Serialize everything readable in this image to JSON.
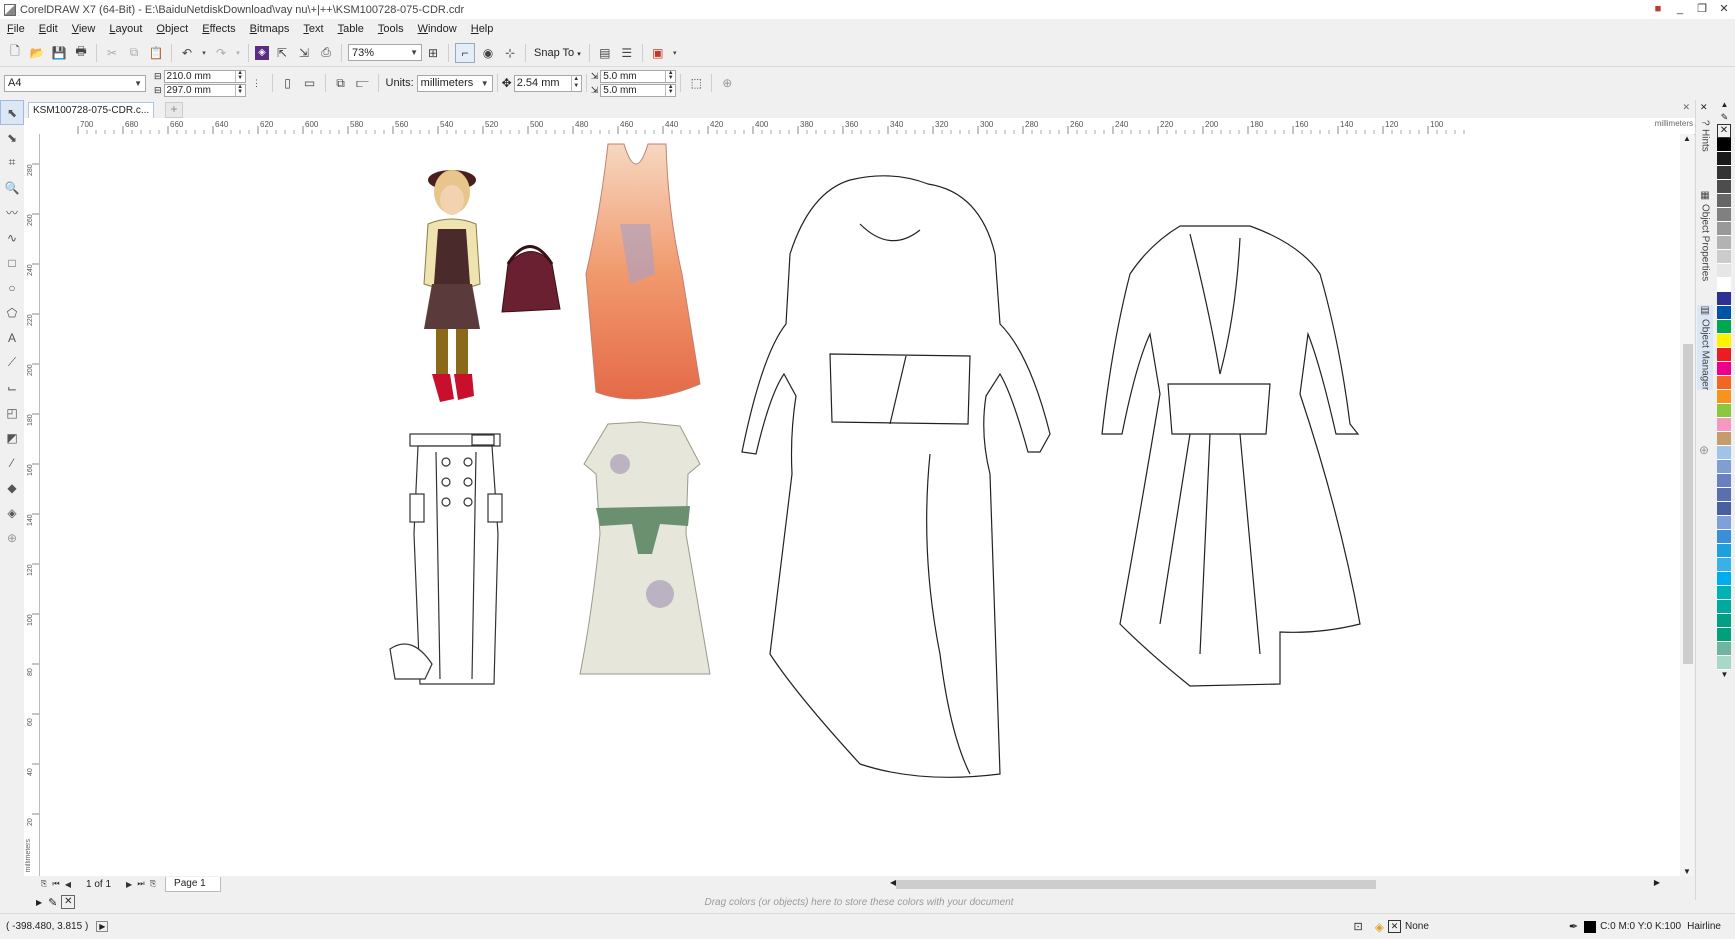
{
  "window": {
    "title": "CorelDRAW X7 (64-Bit) - E:\\BaiduNetdiskDownload\\vay nu\\+|++\\KSM100728-075-CDR.cdr",
    "controls": [
      "_",
      "❐",
      "✕"
    ]
  },
  "menu": [
    "File",
    "Edit",
    "View",
    "Layout",
    "Object",
    "Effects",
    "Bitmaps",
    "Text",
    "Table",
    "Tools",
    "Window",
    "Help"
  ],
  "toolbar": {
    "zoom_value": "73%",
    "snap_label": "Snap To"
  },
  "property_bar": {
    "page_size": "A4",
    "width": "210.0 mm",
    "height": "297.0 mm",
    "units_label": "Units:",
    "units_value": "millimeters",
    "nudge": "2.54 mm",
    "dup_x": "5.0 mm",
    "dup_y": "5.0 mm"
  },
  "document_tab": "KSM100728-075-CDR.c...",
  "ruler": {
    "h_ticks": [
      "700",
      "680",
      "660",
      "640",
      "620",
      "600",
      "580",
      "560",
      "540",
      "520",
      "500",
      "480",
      "460",
      "440",
      "420",
      "400",
      "380",
      "360",
      "340",
      "320",
      "300",
      "280",
      "260",
      "240",
      "220",
      "200",
      "180",
      "160",
      "140",
      "120",
      "100"
    ],
    "h_unit": "millimeters",
    "v_ticks": [
      "280",
      "260",
      "240",
      "220",
      "200",
      "180",
      "160",
      "140",
      "120",
      "100",
      "80",
      "60",
      "40",
      "20"
    ],
    "v_unit": "millimeters"
  },
  "page_nav": {
    "counter": "1 of 1",
    "page_tab": "Page 1"
  },
  "color_tray": {
    "hint": "Drag colors (or objects) here to store these colors with your document"
  },
  "status": {
    "coords": "( -398.480, 3.815 )",
    "fill": "None",
    "outline_color": "C:0 M:0 Y:0 K:100",
    "outline_width": "Hairline"
  },
  "dockers": {
    "hints": "Hints",
    "object_properties": "Object Properties",
    "object_manager": "Object Manager"
  },
  "palette": [
    "#000000",
    "#1a1a1a",
    "#333333",
    "#4d4d4d",
    "#666666",
    "#808080",
    "#999999",
    "#b3b3b3",
    "#cccccc",
    "#e6e6e6",
    "#ffffff",
    "#2e3192",
    "#0054a6",
    "#00a651",
    "#fff200",
    "#ed1c24",
    "#ec008c",
    "#f26522",
    "#f7941d",
    "#8dc63f",
    "#f49ac1",
    "#c69c6d",
    "#a0c4e8",
    "#7f9fd0",
    "#6a7fc0",
    "#5a6fb0",
    "#4a5fa0",
    "#7fa0d8",
    "#3a8fd8",
    "#1ea0e0",
    "#3ab0e8",
    "#00aeef",
    "#00b2b2",
    "#00a99d",
    "#009f86",
    "#00a07a",
    "#6fb6a0",
    "#a8d8c8"
  ]
}
